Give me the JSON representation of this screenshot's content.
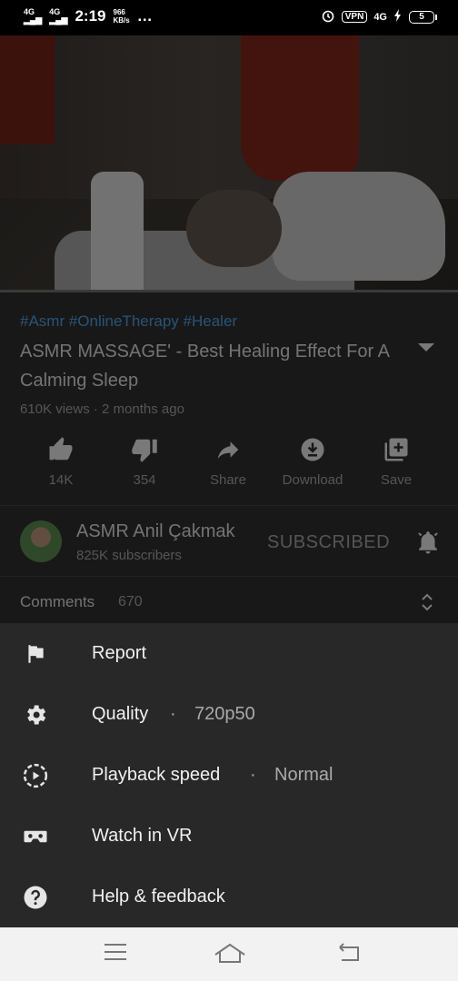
{
  "status_bar": {
    "net1": "4G",
    "net2": "4G",
    "time": "2:19",
    "speed_value": "966",
    "speed_unit": "KB/s",
    "more": "…",
    "vpn": "VPN",
    "net_right": "4G",
    "battery": "5"
  },
  "video": {
    "progress_fraction": 0.0
  },
  "details": {
    "hashtags": "#Asmr #OnlineTherapy #Healer",
    "title": "ASMR MASSAGE' - Best Healing Effect For A Calming Sleep",
    "meta": "610K views · 2 months ago"
  },
  "actions": [
    {
      "icon": "thumb-up-icon",
      "label": "14K"
    },
    {
      "icon": "thumb-down-icon",
      "label": "354"
    },
    {
      "icon": "share-icon",
      "label": "Share"
    },
    {
      "icon": "download-icon",
      "label": "Download"
    },
    {
      "icon": "save-icon",
      "label": "Save"
    }
  ],
  "channel": {
    "name": "ASMR Anil Çakmak",
    "subscribers": "825K subscribers",
    "subscribe_state": "SUBSCRIBED"
  },
  "comments": {
    "label": "Comments",
    "count": "670"
  },
  "menu": [
    {
      "icon": "flag-icon",
      "label": "Report",
      "value": ""
    },
    {
      "icon": "gear-icon",
      "label": "Quality",
      "value": "720p50"
    },
    {
      "icon": "playback-speed-icon",
      "label": "Playback speed",
      "value": "Normal"
    },
    {
      "icon": "vr-headset-icon",
      "label": "Watch in VR",
      "value": ""
    },
    {
      "icon": "help-icon",
      "label": "Help & feedback",
      "value": ""
    }
  ],
  "menu_separator": "·",
  "colors": {
    "accent": "#3ea6ff",
    "progress": "#cc0000",
    "sheet": "#282828"
  }
}
